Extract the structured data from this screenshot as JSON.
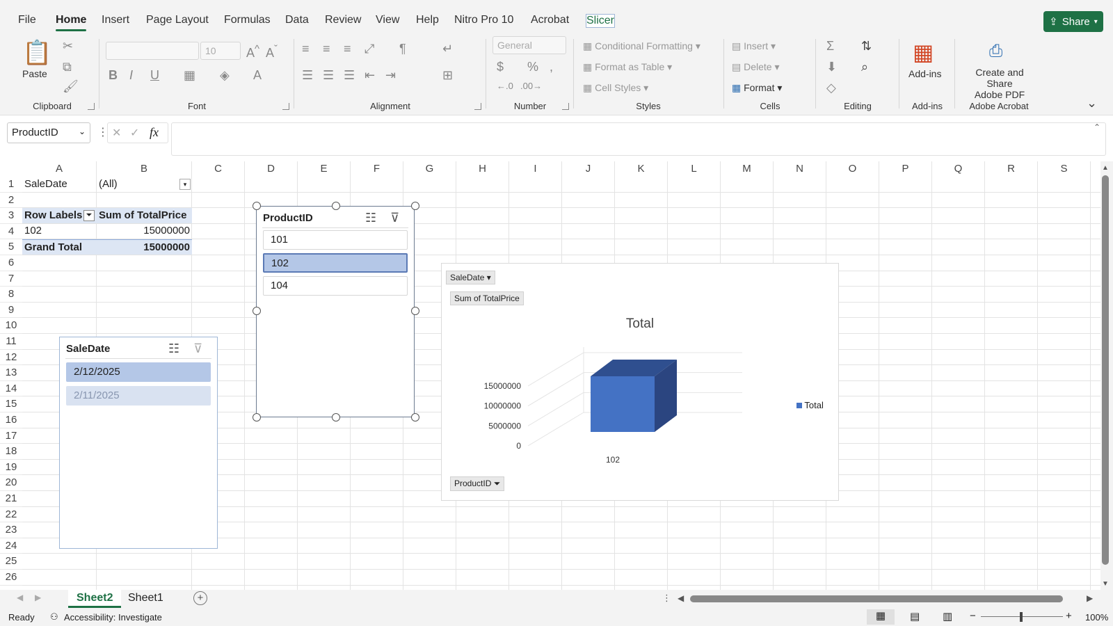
{
  "menu": {
    "tabs": [
      "File",
      "Home",
      "Insert",
      "Page Layout",
      "Formulas",
      "Data",
      "Review",
      "View",
      "Help",
      "Nitro Pro 10",
      "Acrobat",
      "Slicer"
    ],
    "active": "Home",
    "share_label": "Share"
  },
  "ribbon": {
    "clipboard": {
      "label": "Clipboard",
      "paste": "Paste"
    },
    "font": {
      "label": "Font",
      "font_name": "",
      "font_size": "10"
    },
    "alignment": {
      "label": "Alignment"
    },
    "number": {
      "label": "Number",
      "format": "General"
    },
    "styles": {
      "label": "Styles",
      "conditional": "Conditional Formatting",
      "format_table": "Format as Table",
      "cell_styles": "Cell Styles"
    },
    "cells": {
      "label": "Cells",
      "insert": "Insert",
      "delete": "Delete",
      "format": "Format"
    },
    "editing": {
      "label": "Editing"
    },
    "addins": {
      "label": "Add-ins",
      "button": "Add-ins"
    },
    "acrobat": {
      "label": "Adobe Acrobat",
      "line1": "Create and Share",
      "line2": "Adobe PDF"
    }
  },
  "formula_bar": {
    "name_box": "ProductID",
    "fx": "fx",
    "formula": ""
  },
  "grid": {
    "columns": [
      "A",
      "B",
      "C",
      "D",
      "E",
      "F",
      "G",
      "H",
      "I",
      "J",
      "K",
      "L",
      "M",
      "N",
      "O",
      "P",
      "Q",
      "R",
      "S"
    ],
    "rows": [
      "1",
      "2",
      "3",
      "4",
      "5",
      "6",
      "7",
      "8",
      "9",
      "10",
      "11",
      "12",
      "13",
      "14",
      "15",
      "16",
      "17",
      "18",
      "19",
      "20",
      "21",
      "22",
      "23",
      "24",
      "25",
      "26"
    ]
  },
  "pivot": {
    "filter_label": "SaleDate",
    "filter_value": "(All)",
    "row_labels": "Row Labels",
    "value_header": "Sum of TotalPrice",
    "row_key": "102",
    "row_value": "15000000",
    "grand_total_label": "Grand Total",
    "grand_total_value": "15000000"
  },
  "slicer_product": {
    "title": "ProductID",
    "items": [
      "101",
      "102",
      "104"
    ],
    "selected": "102"
  },
  "slicer_date": {
    "title": "SaleDate",
    "items": [
      "2/12/2025",
      "2/11/2025"
    ],
    "selected": "2/12/2025"
  },
  "chart_data": {
    "type": "bar",
    "title": "Total",
    "categories": [
      "102"
    ],
    "series": [
      {
        "name": "Total",
        "values": [
          15000000
        ]
      }
    ],
    "yticks": [
      "0",
      "5000000",
      "10000000",
      "15000000"
    ],
    "ylim": [
      0,
      15000000
    ],
    "legend": "right",
    "filter_buttons": [
      "SaleDate",
      "Sum of TotalPrice",
      "ProductID"
    ],
    "bar_color": "#4472c4"
  },
  "sheets": {
    "tabs": [
      "Sheet2",
      "Sheet1"
    ],
    "active": "Sheet2"
  },
  "status": {
    "ready": "Ready",
    "accessibility": "Accessibility: Investigate",
    "zoom": "100%"
  }
}
